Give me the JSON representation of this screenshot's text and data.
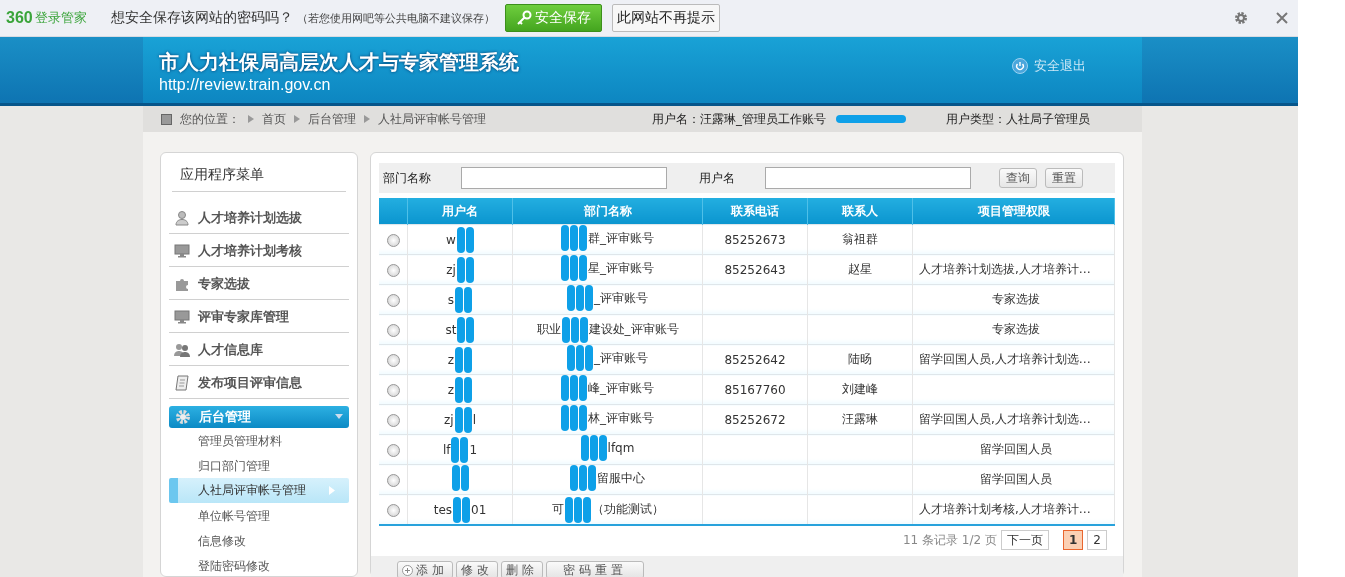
{
  "prompt_bar": {
    "brand_number": "360",
    "brand_name": "登录管家",
    "question": "想安全保存该网站的密码吗？",
    "note": "（若您使用网吧等公共电脑不建议保存）",
    "save_button": "安全保存",
    "never_button": "此网站不再提示"
  },
  "header": {
    "title": "市人力社保局高层次人才与专家管理系统",
    "url": "http://review.train.gov.cn",
    "logout": "安全退出"
  },
  "breadcrumb": {
    "label": "您的位置：",
    "items": [
      "首页",
      "后台管理",
      "人社局评审帐号管理"
    ],
    "user": "用户名：汪露琳_管理员工作账号",
    "user_type": "用户类型：人社局子管理员"
  },
  "sidebar": {
    "title": "应用程序菜单",
    "items": [
      {
        "label": "人才培养计划选拔",
        "kind": "person"
      },
      {
        "label": "人才培养计划考核",
        "kind": "monitor"
      },
      {
        "label": "专家选拔",
        "kind": "puzzle"
      },
      {
        "label": "评审专家库管理",
        "kind": "monitor"
      },
      {
        "label": "人才信息库",
        "kind": "people"
      },
      {
        "label": "发布项目评审信息",
        "kind": "scroll"
      }
    ],
    "group": {
      "label": "后台管理",
      "expanded": true,
      "children": [
        {
          "label": "管理员管理材料",
          "selected": false
        },
        {
          "label": "归口部门管理",
          "selected": false
        },
        {
          "label": "人社局评审帐号管理",
          "selected": true
        },
        {
          "label": "单位帐号管理",
          "selected": false
        },
        {
          "label": "信息修改",
          "selected": false
        },
        {
          "label": "登陆密码修改",
          "selected": false
        }
      ]
    }
  },
  "filter": {
    "fields": [
      {
        "label": "部门名称"
      },
      {
        "label": "用户名"
      }
    ],
    "buttons": [
      "查询",
      "重置"
    ]
  },
  "table": {
    "columns": [
      "用户名",
      "部门名称",
      "联系电话",
      "联系人",
      "项目管理权限"
    ],
    "rows": [
      {
        "selected": false,
        "user": {
          "before": "w"
        },
        "dept": {
          "after": "群_评审账号"
        },
        "phone": "85252673",
        "contact": "翁祖群"
      },
      {
        "selected": false,
        "user": {
          "before": "zj"
        },
        "dept": {
          "after": "星_评审账号"
        },
        "phone": "85252643",
        "contact": "赵星",
        "rights": "人才培养计划选拔,人才培养计…"
      },
      {
        "selected": false,
        "user": {
          "before": "s"
        },
        "dept": {
          "after": "_评审账号"
        },
        "rights": "专家选拔"
      },
      {
        "selected": false,
        "user": {
          "before": "st"
        },
        "dept": {
          "before": "职业",
          "after": "建设处_评审账号"
        },
        "rights": "专家选拔"
      },
      {
        "selected": false,
        "user": {
          "before": "z"
        },
        "dept": {
          "after": "_评审账号"
        },
        "phone": "85252642",
        "contact": "陆旸",
        "rights": "留学回国人员,人才培养计划选…"
      },
      {
        "selected": false,
        "user": {
          "before": "z"
        },
        "dept": {
          "after": "峰_评审账号"
        },
        "phone": "85167760",
        "contact": "刘建峰"
      },
      {
        "selected": false,
        "user": {
          "before": "zj",
          "after": "l"
        },
        "dept": {
          "after": "林_评审账号"
        },
        "phone": "85252672",
        "contact": "汪露琳",
        "rights": "留学回国人员,人才培养计划选…"
      },
      {
        "selected": false,
        "user": {
          "before": "lf",
          "after": "1"
        },
        "dept": {
          "after": "lfqm"
        },
        "rights": "留学回国人员"
      },
      {
        "selected": false,
        "user": {},
        "dept": {
          "after": "留服中心"
        },
        "rights": "留学回国人员"
      },
      {
        "selected": false,
        "user": {
          "before": "tes",
          "after": "01"
        },
        "dept": {
          "before": "可",
          "after": "（功能测试）"
        },
        "rights": "人才培养计划考核,人才培养计…"
      }
    ]
  },
  "pagination": {
    "summary": "11 条记录 1/2 页",
    "next": "下一页",
    "pages": [
      {
        "label": "1",
        "selected": true
      },
      {
        "label": "2",
        "selected": false
      }
    ]
  },
  "actions": [
    {
      "label": "添加",
      "kind": "add"
    },
    {
      "label": "修改",
      "kind": "plain"
    },
    {
      "label": "删除",
      "kind": "plain"
    },
    {
      "label": "密码重置",
      "kind": "wide"
    }
  ]
}
